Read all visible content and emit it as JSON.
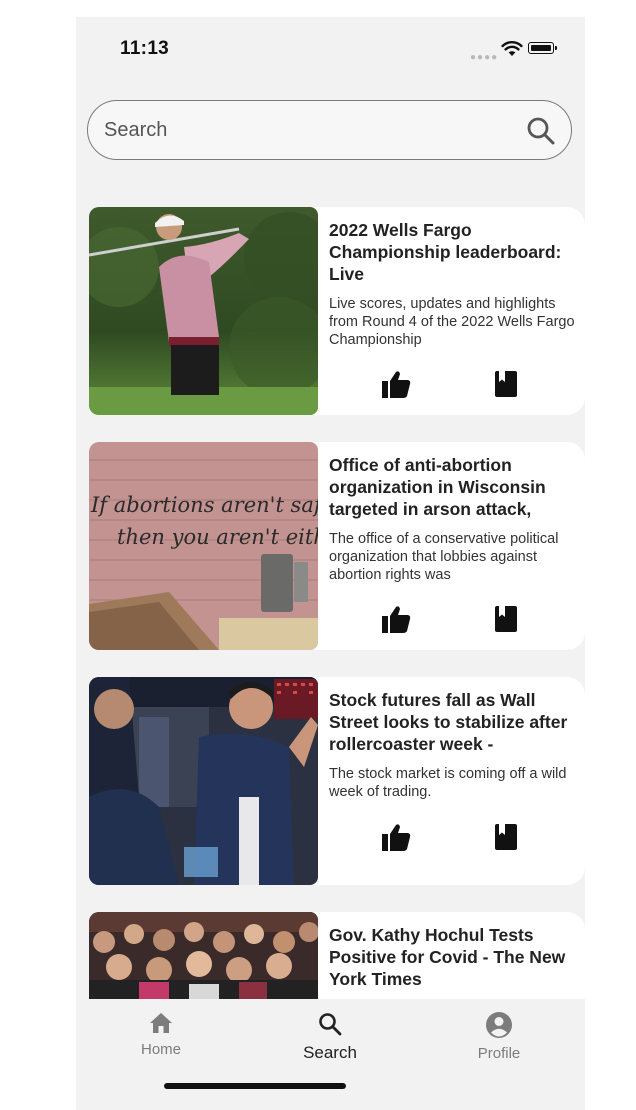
{
  "status_bar": {
    "time": "11:13"
  },
  "search": {
    "placeholder": "Search",
    "value": ""
  },
  "articles": [
    {
      "title": "2022 Wells Fargo Championship leaderboard: Live",
      "description": "Live scores, updates and highlights from Round 4 of the 2022 Wells Fargo Championship",
      "image": "golfer-swing-photo"
    },
    {
      "title": "Office of anti-abortion organization in Wisconsin targeted in arson attack,",
      "description": "The office of a conservative political organization that lobbies against abortion rights was",
      "image": "graffiti-wall-photo",
      "graffiti_line1": "If abortions aren't safe",
      "graffiti_line2": "then you aren't either"
    },
    {
      "title": "Stock futures fall as Wall Street looks to stabilize after rollercoaster week -",
      "description": "The stock market is coming off a wild week of trading.",
      "image": "trading-floor-photo"
    },
    {
      "title": "Gov. Kathy Hochul Tests Positive for Covid - The New York Times",
      "description": "",
      "image": "crowd-photo"
    }
  ],
  "icons": {
    "like": "thumbs-up-icon",
    "save": "bookmark-icon"
  },
  "tab_bar": {
    "home": {
      "label": "Home",
      "icon": "home-icon"
    },
    "search": {
      "label": "Search",
      "icon": "search-icon",
      "active": true
    },
    "profile": {
      "label": "Profile",
      "icon": "profile-icon"
    }
  },
  "colors": {
    "background": "#f2f2f2",
    "card": "#ffffff",
    "text": "#222222",
    "inactive_tab": "#7c7c7c"
  }
}
